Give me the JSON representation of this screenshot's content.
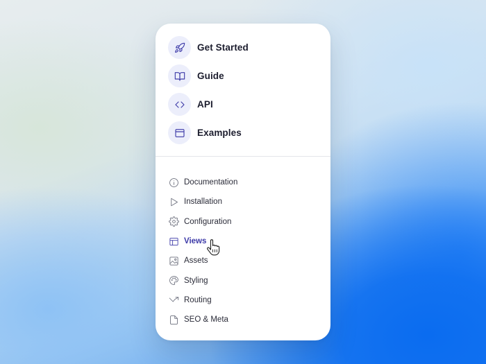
{
  "menu": {
    "primary": [
      {
        "label": "Get Started",
        "icon": "rocket-icon"
      },
      {
        "label": "Guide",
        "icon": "book-icon"
      },
      {
        "label": "API",
        "icon": "code-icon"
      },
      {
        "label": "Examples",
        "icon": "window-icon"
      }
    ],
    "secondary": [
      {
        "label": "Documentation",
        "icon": "info-icon"
      },
      {
        "label": "Installation",
        "icon": "play-icon"
      },
      {
        "label": "Configuration",
        "icon": "gear-icon"
      },
      {
        "label": "Views",
        "icon": "layout-icon",
        "active": true
      },
      {
        "label": "Assets",
        "icon": "image-icon"
      },
      {
        "label": "Styling",
        "icon": "palette-icon"
      },
      {
        "label": "Routing",
        "icon": "trend-arrow-icon"
      },
      {
        "label": "SEO & Meta",
        "icon": "file-icon"
      }
    ]
  },
  "colors": {
    "accent": "#3d3aa8",
    "icon_bubble": "#eceefb",
    "text": "#1c1d2e",
    "muted_icon": "#6b6e7c"
  },
  "cursor": "pointer-hand-icon"
}
